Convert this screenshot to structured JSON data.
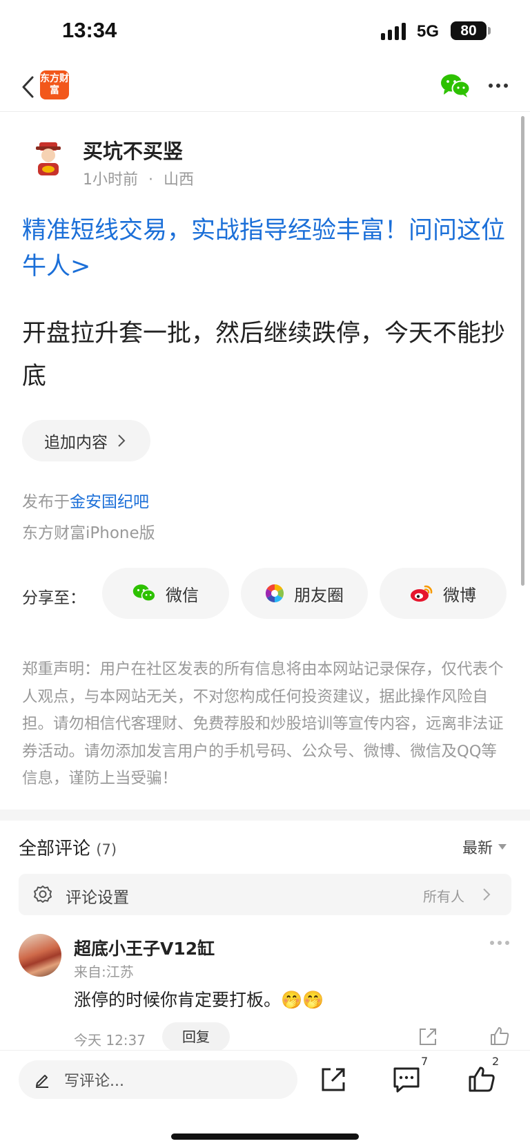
{
  "status_bar": {
    "time": "13:34",
    "network": "5G",
    "battery": "80"
  },
  "nav": {
    "app_logo": "东方财富",
    "icons": [
      "back-icon",
      "wechat-icon",
      "more-icon"
    ]
  },
  "post": {
    "author": "买坑不买竖",
    "time_ago": "1小时前",
    "separator": "·",
    "location": "山西",
    "promo_text": "精准短线交易，实战指导经验丰富！问问这位牛人>",
    "body": "开盘拉升套一批，然后继续跌停，今天不能抄底",
    "append_label": "追加内容",
    "published_prefix": "发布于",
    "bar_name": "金安国纪吧",
    "client": "东方财富iPhone版"
  },
  "share": {
    "label": "分享至：",
    "wechat": "微信",
    "moments": "朋友圈",
    "weibo": "微博"
  },
  "disclaimer": "郑重声明：用户在社区发表的所有信息将由本网站记录保存，仅代表个人观点，与本网站无关，不对您构成任何投资建议，据此操作风险自担。请勿相信代客理财、免费荐股和炒股培训等宣传内容，远离非法证券活动。请勿添加发言用户的手机号码、公众号、微博、微信及QQ等信息，谨防上当受骗！",
  "comments": {
    "title": "全部评论",
    "count": "(7)",
    "sort": "最新",
    "settings_label": "评论设置",
    "settings_value": "所有人",
    "items": [
      {
        "name": "超底小王子V12缸",
        "location": "来自:江苏",
        "text": "涨停的时候你肯定要打板。🤭🤭",
        "time": "今天 12:37",
        "reply_label": "回复"
      }
    ]
  },
  "bottom_bar": {
    "placeholder": "写评论...",
    "comment_count": "7",
    "like_count": "2"
  },
  "colors": {
    "link": "#1b6fd8",
    "brand": "#f2571b",
    "wechat": "#2dc100"
  }
}
